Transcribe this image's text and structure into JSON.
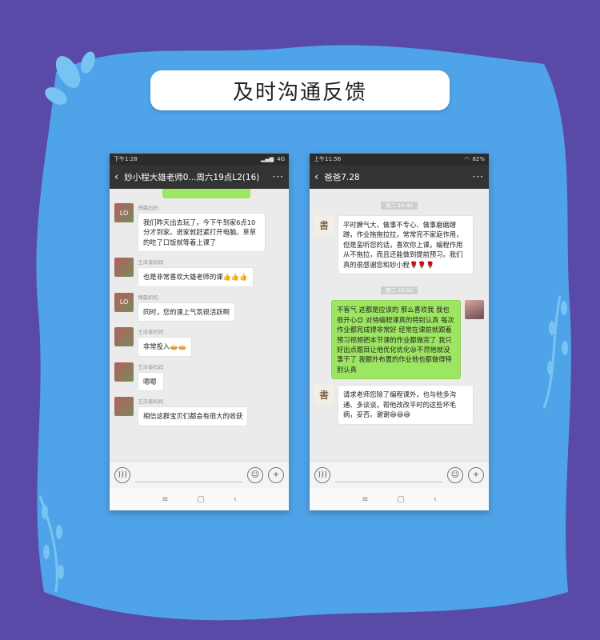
{
  "page": {
    "title": "及时沟通反馈"
  },
  "colors": {
    "background": "#5a4aa8",
    "blob": "#4fa3e8",
    "my_bubble": "#9de661",
    "navbar": "#333333"
  },
  "left_phone": {
    "status_time": "下午1:28",
    "status_right": "4G",
    "chat_title": "妙小程大雄老师0...周六19点L2(16)",
    "messages": [
      {
        "nick": "博晨妈妈",
        "text": "我们昨天出去玩了，今下午到家6点10分才到家。进家就赶紧打开电脑。草草的吃了口饭就等着上课了"
      },
      {
        "nick": "王泽泰妈妈",
        "text": "也是非常喜欢大雄老师的课👍👍👍"
      },
      {
        "nick": "博晨妈妈",
        "text": "同时，您的课上气氛很活跃啊"
      },
      {
        "nick": "王泽泰妈妈",
        "text": "非常投入🥧🥧"
      },
      {
        "nick": "王泽泰妈妈",
        "text": "嗯嗯"
      },
      {
        "nick": "王泽泰妈妈",
        "text": "相信这群宝贝们都会有很大的收获"
      }
    ]
  },
  "right_phone": {
    "status_time": "上午11:56",
    "status_right": "82%",
    "chat_title": "爸爸7.28",
    "time1": "周二 16:45",
    "msg1": "平时脾气大、做事不专心、做事磨磨蹭蹭，作业拖拖拉拉，常常完不家庭作用，但是蛮听您的话，喜欢你上课，编程作用从不拖拉，而且还能做到提前预习。我们真的很感谢您和妙小程🌹🌹🌹",
    "time2": "周二 16:52",
    "msg2": "不客气 这都是应该的 那么喜欢我 我也很开心😊 对待编程课真的特别认真 每次作业都完成得非常好 经常在课前就跟着预习视频把本节课的作业都做完了 我只好出点题目让他优化优化😝不然他就没事干了 我额外布置的作业他也都做得特别认真",
    "msg3": "请求老师您除了编程课外，也与他多沟通、多谈谈，帮他改改平时的这些坏毛病，妥否。谢谢😆😆😆"
  },
  "icons": {
    "back": "chevron-left-icon",
    "more": "more-dots-icon",
    "voice": "voice-icon",
    "emoji": "emoji-icon",
    "plus": "plus-icon"
  }
}
